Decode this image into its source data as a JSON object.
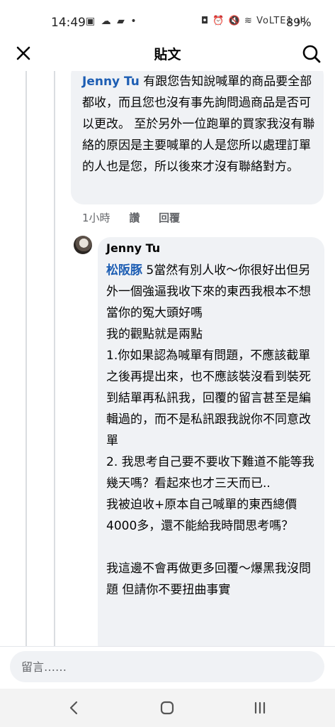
{
  "status_bar": {
    "time": "14:49",
    "left_icons": "▣ ☁ ▰ •",
    "right_icons": "◘ ⏰ 🔇 ≋ VoLTE1 ıll",
    "battery": "89%"
  },
  "header": {
    "title": "貼文"
  },
  "comment_1": {
    "mention": "Jenny Tu",
    "text": " 有跟您告知說喊單的商品要全部都收，而且您也沒有事先詢問過商品是否可以更改。 至於另外一位跑單的買家我沒有聯絡的原因是主要喊單的人是您所以處理訂單的人也是您，所以後來才沒有聯絡對方。",
    "time": "1小時",
    "like": "讚",
    "reply": "回覆"
  },
  "comment_2": {
    "author": "Jenny Tu",
    "mention": "松阪豚",
    "line1": " 5當然有別人收～你很好出但另外一個強逼我收下來的東西我根本不想當你的冤大頭好嗎",
    "line2": "我的觀點就是兩點",
    "line3": "1.你如果認為喊單有問題，不應該截單之後再提出來，也不應該裝沒看到裝死到結單再私訊我，回覆的留言甚至是編輯過的，而不是私訊跟我說你不同意改單",
    "line4": "2. 我思考自己要不要收下難道不能等我幾天嗎？看起來也才三天而已..",
    "line5": "我被迫收+原本自己喊單的東西總價4000多，還不能給我時間思考嗎？",
    "line6": "我這邊不會再做更多回覆～爆黑我沒問題 但請你不要扭曲事實"
  },
  "input": {
    "placeholder": "留言……"
  },
  "colors": {
    "mention": "#1c5db3",
    "bubble": "#f0f2f5",
    "meta": "#65676b"
  }
}
